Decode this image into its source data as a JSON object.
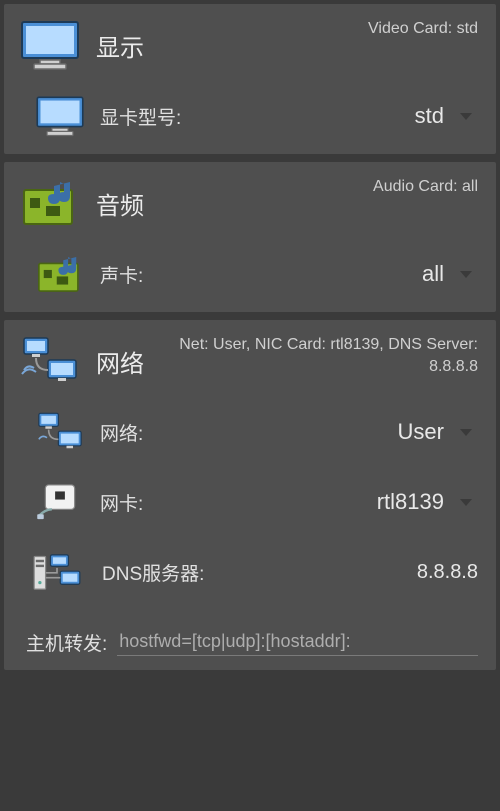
{
  "display": {
    "title": "显示",
    "summary": "Video Card: std",
    "model_label": "显卡型号:",
    "model_value": "std"
  },
  "audio": {
    "title": "音频",
    "summary": "Audio Card: all",
    "card_label": "声卡:",
    "card_value": "all"
  },
  "network": {
    "title": "网络",
    "summary": "Net: User, NIC Card: rtl8139, DNS Server: 8.8.8.8",
    "net_label": "网络:",
    "net_value": "User",
    "nic_label": "网卡:",
    "nic_value": "rtl8139",
    "dns_label": "DNS服务器:",
    "dns_value": "8.8.8.8",
    "hostfwd_label": "主机转发:",
    "hostfwd_value": "hostfwd=[tcp|udp]:[hostaddr]:"
  }
}
